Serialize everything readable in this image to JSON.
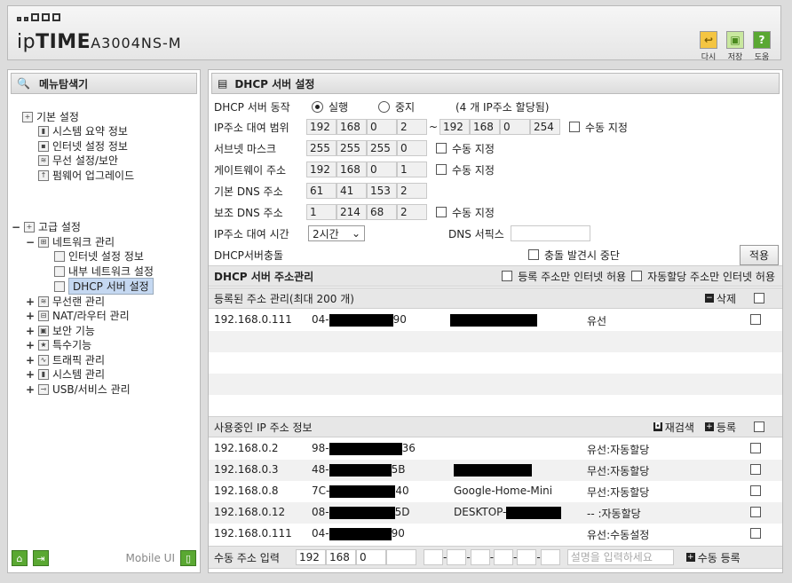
{
  "header": {
    "brand_prefix": "ip",
    "brand_main": "TIME",
    "model": "A3004NS-M",
    "icons": [
      {
        "name": "logout-icon",
        "label": "다시"
      },
      {
        "name": "save-icon",
        "label": "저장"
      },
      {
        "name": "help-icon",
        "label": "도움"
      }
    ]
  },
  "sidebar": {
    "title": "메뉴탐색기",
    "basic": {
      "label": "기본 설정",
      "items": [
        "시스템 요약 정보",
        "인터넷 설정 정보",
        "무선 설정/보안",
        "펌웨어 업그레이드"
      ]
    },
    "advanced": {
      "label": "고급 설정",
      "network": "네트워크 관리",
      "network_items": [
        "인터넷 설정 정보",
        "내부 네트워크 설정",
        "DHCP 서버 설정"
      ],
      "groups": [
        "무선랜 관리",
        "NAT/라우터 관리",
        "보안 기능",
        "특수기능",
        "트래픽 관리",
        "시스템 관리",
        "USB/서비스 관리"
      ]
    },
    "mobile_label": "Mobile UI"
  },
  "main": {
    "title": "DHCP 서버 설정",
    "server_action_label": "DHCP 서버 동작",
    "run_label": "실행",
    "stop_label": "중지",
    "alloc_note": "(4 개 IP주소 할당됨)",
    "range_label": "IP주소 대여 범위",
    "range_start": [
      "192",
      "168",
      "0",
      "2"
    ],
    "range_end": [
      "192",
      "168",
      "0",
      "254"
    ],
    "range_tilde": "~",
    "manual_label": "수동 지정",
    "subnet_label": "서브넷 마스크",
    "subnet": [
      "255",
      "255",
      "255",
      "0"
    ],
    "gateway_label": "게이트웨이 주소",
    "gateway": [
      "192",
      "168",
      "0",
      "1"
    ],
    "dns1_label": "기본 DNS 주소",
    "dns1": [
      "61",
      "41",
      "153",
      "2"
    ],
    "dns2_label": "보조 DNS 주소",
    "dns2": [
      "1",
      "214",
      "68",
      "2"
    ],
    "lease_label": "IP주소 대여 시간",
    "lease_value": "2시간",
    "dns_suffix_label": "DNS 서픽스",
    "conflict_label": "DHCP서버충돌",
    "conflict_stop_label": "충돌 발견시 중단",
    "apply_button": "적용",
    "addr_mgmt_label": "DHCP 서버 주소관리",
    "registered_only_label": "등록 주소만 인터넷 허용",
    "auto_only_label": "자동할당 주소만 인터넷 허용",
    "registered_header": "등록된 주소 관리(최대 200 개)",
    "delete_label": "삭제",
    "registered_rows": [
      {
        "ip": "192.168.0.111",
        "mac_start": "04-",
        "mac_end": "90",
        "type": "유선"
      }
    ],
    "inuse_header": "사용중인 IP 주소 정보",
    "rescan_label": "재검색",
    "register_label": "등록",
    "inuse_rows": [
      {
        "ip": "192.168.0.2",
        "mac_start": "98-",
        "mac_end": "36",
        "name": "",
        "type": "유선:자동할당"
      },
      {
        "ip": "192.168.0.3",
        "mac_start": "48-",
        "mac_end": "5B",
        "name": "",
        "type": "무선:자동할당"
      },
      {
        "ip": "192.168.0.8",
        "mac_start": "7C-",
        "mac_end": "40",
        "name": "Google-Home-Mini",
        "type": "무선:자동할당"
      },
      {
        "ip": "192.168.0.12",
        "mac_start": "08-",
        "mac_end": "5D",
        "name": "DESKTOP-",
        "type": "-- :자동할당"
      },
      {
        "ip": "192.168.0.111",
        "mac_start": "04-",
        "mac_end": "90",
        "name": "",
        "type": "유선:수동설정"
      }
    ],
    "manual_input_label": "수동 주소 입력",
    "manual_ip": [
      "192",
      "168",
      "0",
      ""
    ],
    "description_placeholder": "설명을 입력하세요",
    "manual_register_label": "수동 등록"
  }
}
